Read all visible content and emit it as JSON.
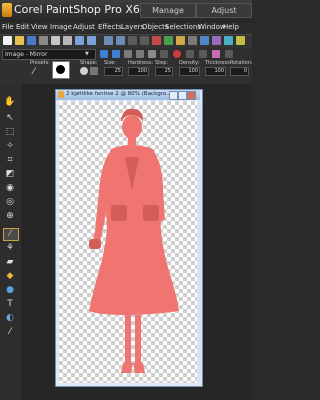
{
  "app": {
    "title": "Corel PaintShop Pro X6",
    "workspace_tabs": [
      "Manage",
      "Adjust"
    ]
  },
  "menu": [
    "File",
    "Edit",
    "View",
    "Image",
    "Adjust",
    "Effects",
    "Layers",
    "Objects",
    "Selections",
    "Window",
    "Help"
  ],
  "toolbar": {
    "preset_select": "Image - Mirror"
  },
  "tool_options": {
    "labels": [
      "Presets:",
      "Shape:",
      "Size:",
      "Hardness:",
      "Step:",
      "Density:",
      "Thickness:",
      "Rotation:"
    ],
    "values": [
      "",
      "",
      "25",
      "100",
      "25",
      "100",
      "100",
      "0"
    ]
  },
  "document": {
    "title": "2 kjøttlike fentise 2 @ 80% (Backgro..."
  },
  "colors": {
    "figure_fill": "#f07570",
    "app_bg": "#2a2a2a",
    "doc_frame": "#6f8fb5"
  },
  "tools": [
    "pan-icon",
    "pick-icon",
    "select-icon",
    "freehand-select-icon",
    "crop-icon",
    "straighten-icon",
    "makeover-icon",
    "red-eye-icon",
    "clone-icon",
    "brush-icon",
    "retouch-icon",
    "eraser-icon",
    "fill-icon",
    "text-icon",
    "preset-shape-icon",
    "pen-icon",
    "warp-brush-icon"
  ]
}
